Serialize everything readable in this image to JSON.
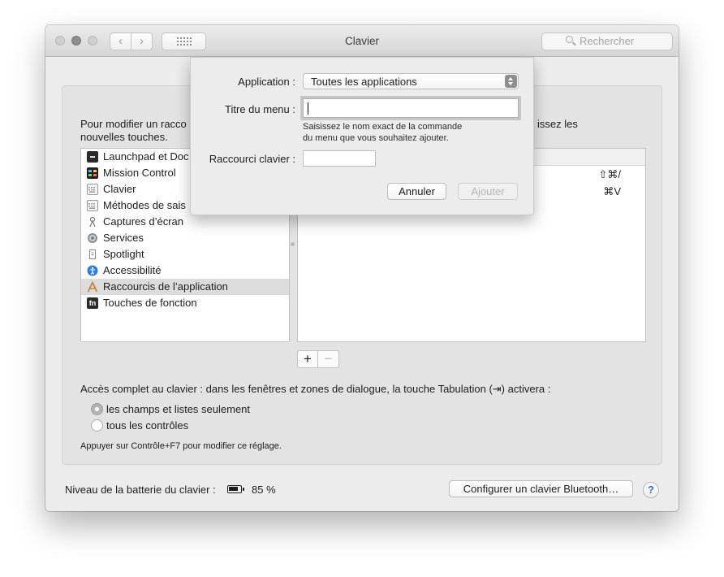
{
  "window": {
    "title": "Clavier"
  },
  "search": {
    "placeholder": "Rechercher"
  },
  "instructions": {
    "line1_left": "Pour modifier un racco",
    "line1_right": "issez les",
    "line2": "nouvelles touches."
  },
  "categories": [
    {
      "label": "Launchpad et Doc",
      "icon": "launchpad-icon"
    },
    {
      "label": "Mission Control",
      "icon": "mission-control-icon"
    },
    {
      "label": "Clavier",
      "icon": "keyboard-icon"
    },
    {
      "label": "Méthodes de sais",
      "icon": "input-sources-icon"
    },
    {
      "label": "Captures d’écran",
      "icon": "screenshot-icon"
    },
    {
      "label": "Services",
      "icon": "gear-icon"
    },
    {
      "label": "Spotlight",
      "icon": "document-icon"
    },
    {
      "label": "Accessibilité",
      "icon": "accessibility-icon"
    },
    {
      "label": "Raccourcis de l’application",
      "icon": "app-shortcuts-icon",
      "selected": true
    },
    {
      "label": "Touches de fonction",
      "icon": "fn-icon"
    }
  ],
  "shortcuts": [
    {
      "keys": "⇧⌘/"
    },
    {
      "keys": "⌘V"
    }
  ],
  "list_buttons": {
    "add": "+",
    "remove": "−"
  },
  "keyboard_access": {
    "label": "Accès complet au clavier : dans les fenêtres et zones de dialogue, la touche Tabulation (⇥) activera :",
    "options": [
      {
        "label": "les champs et listes seulement",
        "selected": true
      },
      {
        "label": "tous les contrôles",
        "selected": false
      }
    ],
    "hint": "Appuyer sur Contrôle+F7 pour modifier ce réglage."
  },
  "battery": {
    "label": "Niveau de la batterie du clavier :",
    "value": "85 %",
    "level_percent": 85
  },
  "bluetooth_button": "Configurer un clavier Bluetooth…",
  "help_button": "?",
  "sheet": {
    "application_label": "Application :",
    "application_value": "Toutes les applications",
    "menu_title_label": "Titre du menu :",
    "menu_title_value": "",
    "hint_line1": "Saisissez le nom exact de la commande",
    "hint_line2": "du menu que vous souhaitez ajouter.",
    "shortcut_label": "Raccourci clavier :",
    "cancel": "Annuler",
    "add": "Ajouter"
  },
  "colors": {
    "accent": "#2b6fe0",
    "window_bg": "#ececec",
    "selection": "#dcdcdc"
  }
}
